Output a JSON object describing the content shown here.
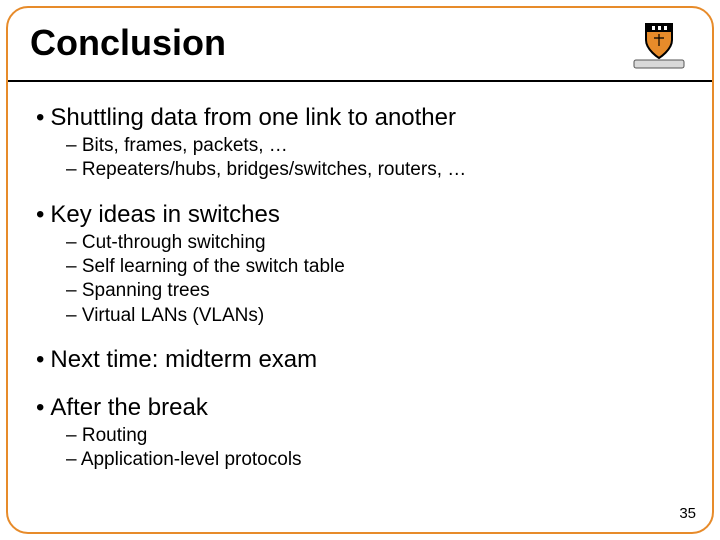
{
  "title": "Conclusion",
  "page_number": "35",
  "bullets": {
    "b1": {
      "text": "Shuttling data from one link to another",
      "subs": [
        "Bits, frames, packets, …",
        "Repeaters/hubs, bridges/switches, routers, …"
      ]
    },
    "b2": {
      "text": "Key ideas in switches",
      "subs": [
        "Cut-through switching",
        "Self learning of the switch table",
        "Spanning trees",
        "Virtual LANs (VLANs)"
      ]
    },
    "b3": {
      "text": "Next time: midterm exam",
      "subs": []
    },
    "b4": {
      "text": "After the break",
      "subs": [
        "Routing",
        "Application-level protocols"
      ]
    }
  }
}
